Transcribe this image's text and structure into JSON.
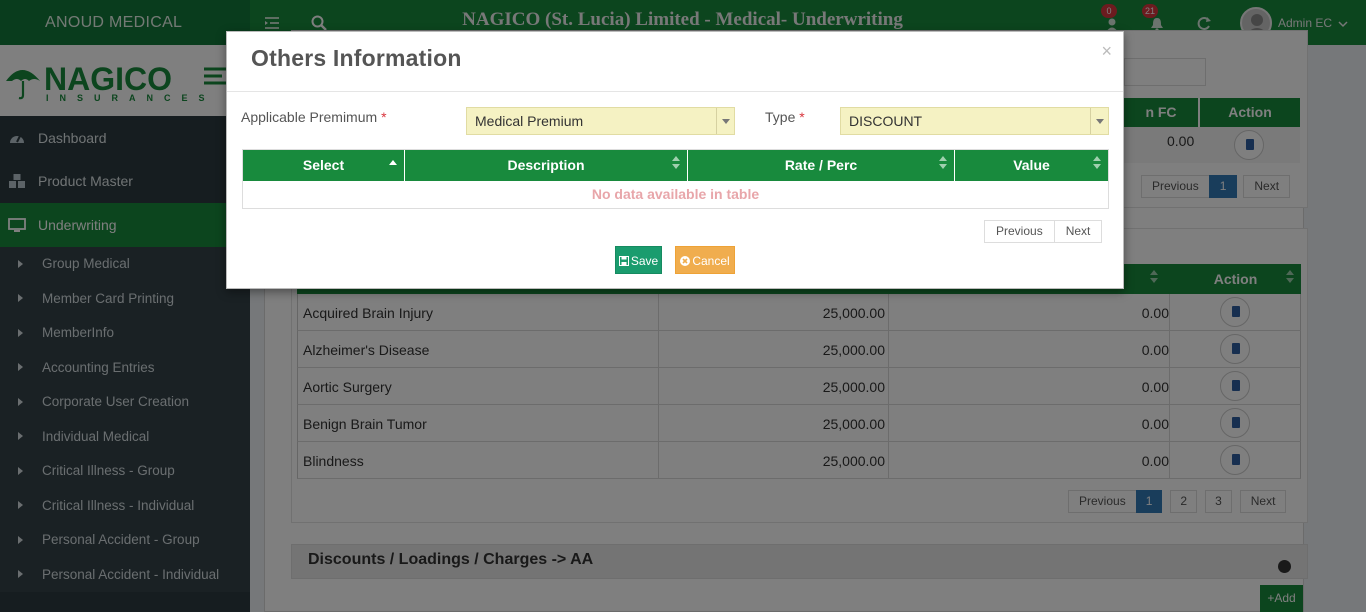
{
  "header": {
    "app_name": "ANOUD MEDICAL",
    "title": "NAGICO (St. Lucia) Limited - Medical- Underwriting",
    "user_badge": "0",
    "notif_badge": "21",
    "user_name": "Admin EC"
  },
  "logo": {
    "text": "NAGICO",
    "subtext": "INSURANCES"
  },
  "sidebar": {
    "items": [
      {
        "label": "Dashboard",
        "icon": "dashboard-icon"
      },
      {
        "label": "Product Master",
        "icon": "cubes-icon"
      },
      {
        "label": "Underwriting",
        "icon": "desktop-icon",
        "active": true
      }
    ],
    "sub_items": [
      "Group Medical",
      "Member Card Printing",
      "MemberInfo",
      "Accounting Entries",
      "Corporate User Creation",
      "Individual Medical",
      "Critical Illness - Group",
      "Critical Illness - Individual",
      "Personal Accident - Group",
      "Personal Accident - Individual"
    ]
  },
  "background": {
    "top_table": {
      "col_fc": "n FC",
      "col_action": "Action",
      "value": "0.00"
    },
    "top_pager": {
      "prev": "Previous",
      "page": "1",
      "next": "Next"
    },
    "mid_table": {
      "col_action": "Action",
      "rows": [
        {
          "name": "Acquired Brain Injury",
          "amount": "25,000.00",
          "value": "0.00"
        },
        {
          "name": "Alzheimer's Disease",
          "amount": "25,000.00",
          "value": "0.00"
        },
        {
          "name": "Aortic Surgery",
          "amount": "25,000.00",
          "value": "0.00"
        },
        {
          "name": "Benign Brain Tumor",
          "amount": "25,000.00",
          "value": "0.00"
        },
        {
          "name": "Blindness",
          "amount": "25,000.00",
          "value": "0.00"
        }
      ]
    },
    "mid_pager": {
      "prev": "Previous",
      "pages": [
        "1",
        "2",
        "3"
      ],
      "next": "Next"
    },
    "section_title": "Discounts / Loadings / Charges -> AA",
    "add_label": "Add"
  },
  "modal": {
    "title": "Others Information",
    "close": "×",
    "premium_label": "Applicable Premimum",
    "premium_value": "Medical Premium",
    "type_label": "Type",
    "type_value": "DISCOUNT",
    "required_mark": "*",
    "columns": [
      "Select",
      "Description",
      "Rate / Perc",
      "Value"
    ],
    "empty_message": "No data available in table",
    "pager_prev": "Previous",
    "pager_next": "Next",
    "save_label": "Save",
    "cancel_label": "Cancel"
  },
  "colors": {
    "brand_green": "#188a3d",
    "sidebar_bg": "#2c3b41",
    "select_bg": "#f5f2c3",
    "save": "#1a9c6e",
    "cancel": "#f0ad4e",
    "badge": "#d9363e"
  }
}
